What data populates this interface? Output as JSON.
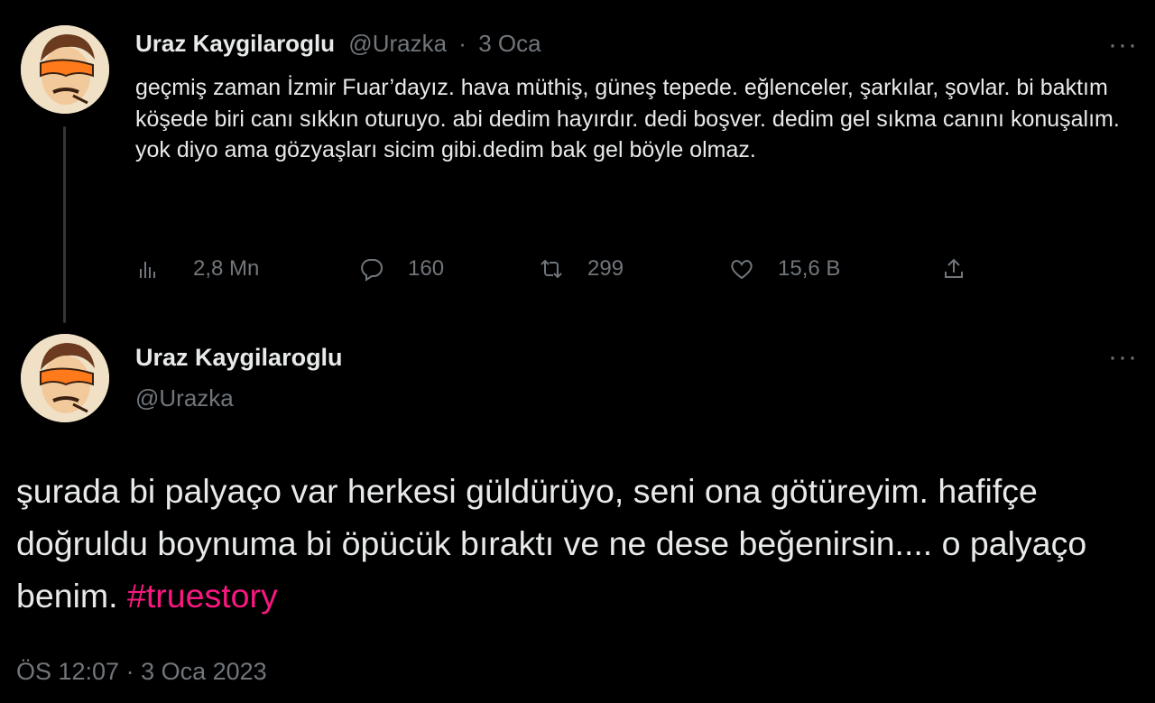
{
  "tweet1": {
    "author_name": "Uraz Kaygilaroglu",
    "handle": "@Urazka",
    "separator": "·",
    "date": "3 Oca",
    "text": "geçmiş zaman İzmir Fuar’dayız. hava müthiş, güneş tepede. eğlenceler, şarkılar, şovlar. bi baktım köşede biri canı sıkkın oturuyo. abi dedim hayırdır. dedi boşver. dedim gel sıkma canını konuşalım. yok diyo ama gözyaşları sicim gibi.dedim bak gel böyle olmaz.",
    "more": "···",
    "actions": {
      "views": {
        "icon": "analytics-icon",
        "count": "2,8 Mn"
      },
      "replies": {
        "icon": "reply-icon",
        "count": "160"
      },
      "retweets": {
        "icon": "retweet-icon",
        "count": "299"
      },
      "likes": {
        "icon": "heart-icon",
        "count": "15,6 B"
      },
      "share": {
        "icon": "share-icon"
      }
    }
  },
  "tweet2": {
    "author_name": "Uraz Kaygilaroglu",
    "handle": "@Urazka",
    "more": "···",
    "text": "şurada bi palyaço var herkesi güldürüyo, seni ona götüreyim. hafifçe  doğruldu boynuma bi öpücük bıraktı ve ne dese beğenirsin.... o palyaço benim.",
    "hashtag": "#truestory",
    "timestamp": "ÖS 12:07 · 3 Oca 2023"
  },
  "colors": {
    "background": "#000000",
    "text": "#e7e9ea",
    "muted": "#71767b",
    "hashtag": "#f91880",
    "thread_line": "#333639"
  }
}
